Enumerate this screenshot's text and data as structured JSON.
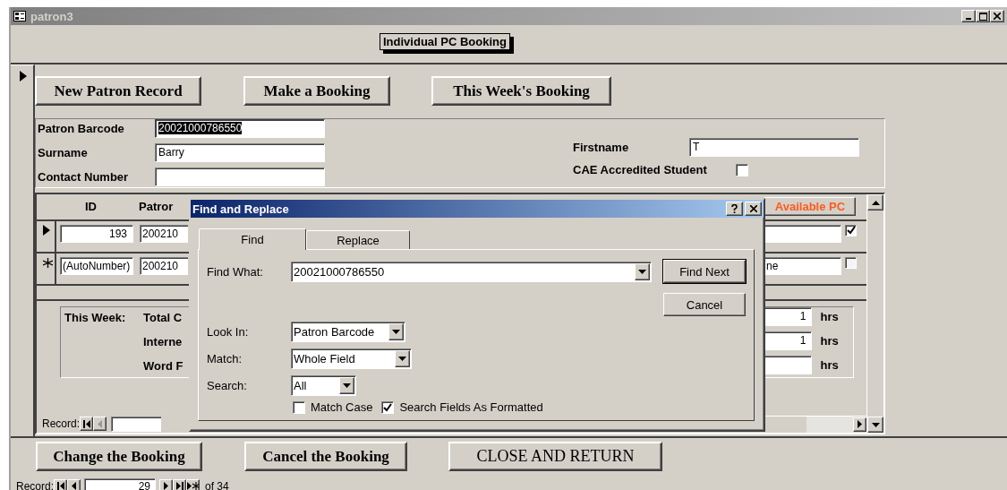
{
  "window": {
    "title": "patron3"
  },
  "form_title": "Individual PC Booking",
  "top_buttons": [
    "New Patron Record",
    "Make a Booking",
    "This Week's Booking"
  ],
  "patron": {
    "fields": [
      {
        "label": "Patron Barcode",
        "value": "20021000786550",
        "highlighted": true
      },
      {
        "label": "Surname",
        "value": "Barry",
        "highlighted": false
      },
      {
        "label": "Contact Number",
        "highlighted": false
      }
    ],
    "firstname": {
      "label": "Firstname",
      "value": "T"
    },
    "cae": {
      "label": "CAE Accredited Student",
      "checked": false
    }
  },
  "subform": {
    "columns": [
      "ID",
      "Patror",
      "Available PC"
    ],
    "rows": [
      {
        "kind": "current",
        "id": "193",
        "barcode": "200210",
        "checked": true
      },
      {
        "kind": "new",
        "id": "(AutoNumber)",
        "barcode": "200210",
        "pc": "ne",
        "checked": false
      }
    ],
    "summary": {
      "label": "This Week:",
      "lines": [
        {
          "label": "Total C",
          "value": "1",
          "unit": "hrs"
        },
        {
          "label": "Interne",
          "value": "1",
          "unit": "hrs"
        },
        {
          "label": "Word F",
          "unit": "hrs"
        }
      ]
    },
    "record_label": "Record:"
  },
  "footer_buttons": [
    "Change the Booking",
    "Cancel the Booking",
    "CLOSE AND RETURN"
  ],
  "navigator": {
    "label": "Record:",
    "value": "29",
    "total": "of 34"
  },
  "dialog": {
    "title": "Find and Replace",
    "tabs": [
      {
        "label": "Find",
        "selected": true
      },
      {
        "label": "Replace",
        "selected": false
      }
    ],
    "find_what": {
      "label": "Find What:",
      "value": "20021000786550"
    },
    "buttons": [
      "Find Next",
      "Cancel"
    ],
    "selects": [
      {
        "label": "Look In:",
        "value": "Patron Barcode"
      },
      {
        "label": "Match:",
        "value": "Whole Field"
      },
      {
        "label": "Search:",
        "value": "All"
      }
    ],
    "checkboxes": [
      {
        "label": "Match Case",
        "checked": false
      },
      {
        "label": "Search Fields As Formatted",
        "checked": true
      }
    ]
  }
}
